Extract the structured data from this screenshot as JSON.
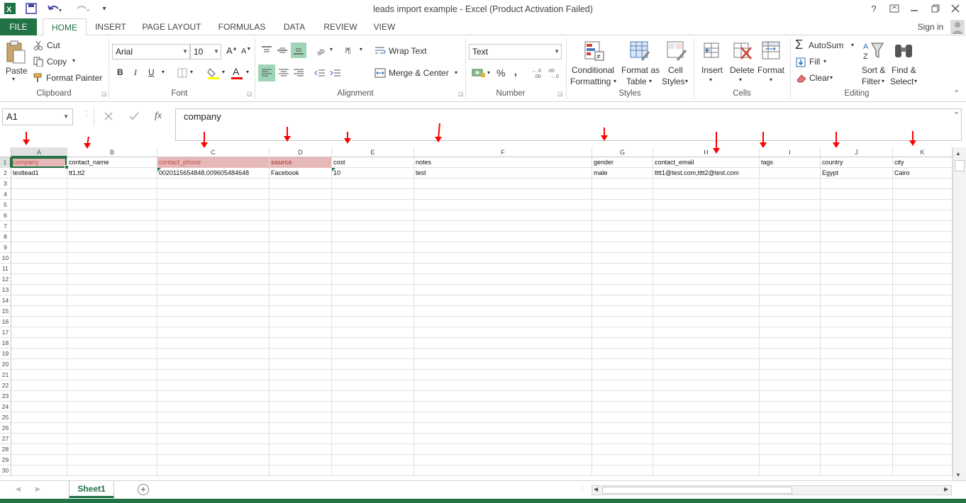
{
  "window": {
    "title": "leads import example - Excel (Product Activation Failed)",
    "sign_in": "Sign in",
    "help": "?"
  },
  "tabs": [
    "FILE",
    "HOME",
    "INSERT",
    "PAGE LAYOUT",
    "FORMULAS",
    "DATA",
    "REVIEW",
    "VIEW"
  ],
  "ribbon": {
    "clipboard": {
      "label": "Clipboard",
      "paste": "Paste",
      "cut": "Cut",
      "copy": "Copy",
      "format_painter": "Format Painter"
    },
    "font": {
      "label": "Font",
      "name": "Arial",
      "size": "10",
      "bold": "B",
      "italic": "I",
      "underline": "U"
    },
    "alignment": {
      "label": "Alignment",
      "wrap": "Wrap Text",
      "merge": "Merge & Center"
    },
    "number": {
      "label": "Number",
      "format": "Text",
      "percent": "%",
      "comma": ","
    },
    "styles": {
      "label": "Styles",
      "conditional": "Conditional",
      "conditional2": "Formatting",
      "format_as": "Format as",
      "format_as2": "Table",
      "cell": "Cell",
      "cell2": "Styles"
    },
    "cells": {
      "label": "Cells",
      "insert": "Insert",
      "delete": "Delete",
      "format": "Format"
    },
    "editing": {
      "label": "Editing",
      "autosum": "AutoSum",
      "fill": "Fill",
      "clear": "Clear",
      "sort": "Sort &",
      "sort2": "Filter",
      "find": "Find &",
      "find2": "Select"
    }
  },
  "formula_bar": {
    "name_box": "A1",
    "fx": "fx",
    "value": "company"
  },
  "columns": [
    "A",
    "B",
    "C",
    "D",
    "E",
    "F",
    "G",
    "H",
    "I",
    "J",
    "K"
  ],
  "rows": [
    [
      "company",
      "contact_name",
      "contact_phone",
      "source",
      "cost",
      "notes",
      "gender",
      "contact_email",
      "tags",
      "country",
      "city"
    ],
    [
      "testlead1",
      "tt1,tt2",
      "0020115654848,009605484648",
      "Facebook",
      "10",
      "test",
      "male",
      "tttt1@test.com,tttt2@test.com",
      "",
      "Egypt",
      "Cairo"
    ]
  ],
  "row_numbers": [
    "1",
    "2",
    "3",
    "4",
    "5",
    "6",
    "7",
    "8",
    "9",
    "10",
    "11",
    "12",
    "13",
    "14",
    "15",
    "16",
    "17",
    "18",
    "19",
    "20",
    "21",
    "22",
    "23",
    "24",
    "25",
    "26",
    "27",
    "28",
    "29",
    "30"
  ],
  "sheet": {
    "name": "Sheet1"
  },
  "colors": {
    "accent": "#217346",
    "header_highlight": "#e6b8b7",
    "source_text": "#c0504d",
    "arrow": "#ff0000"
  }
}
